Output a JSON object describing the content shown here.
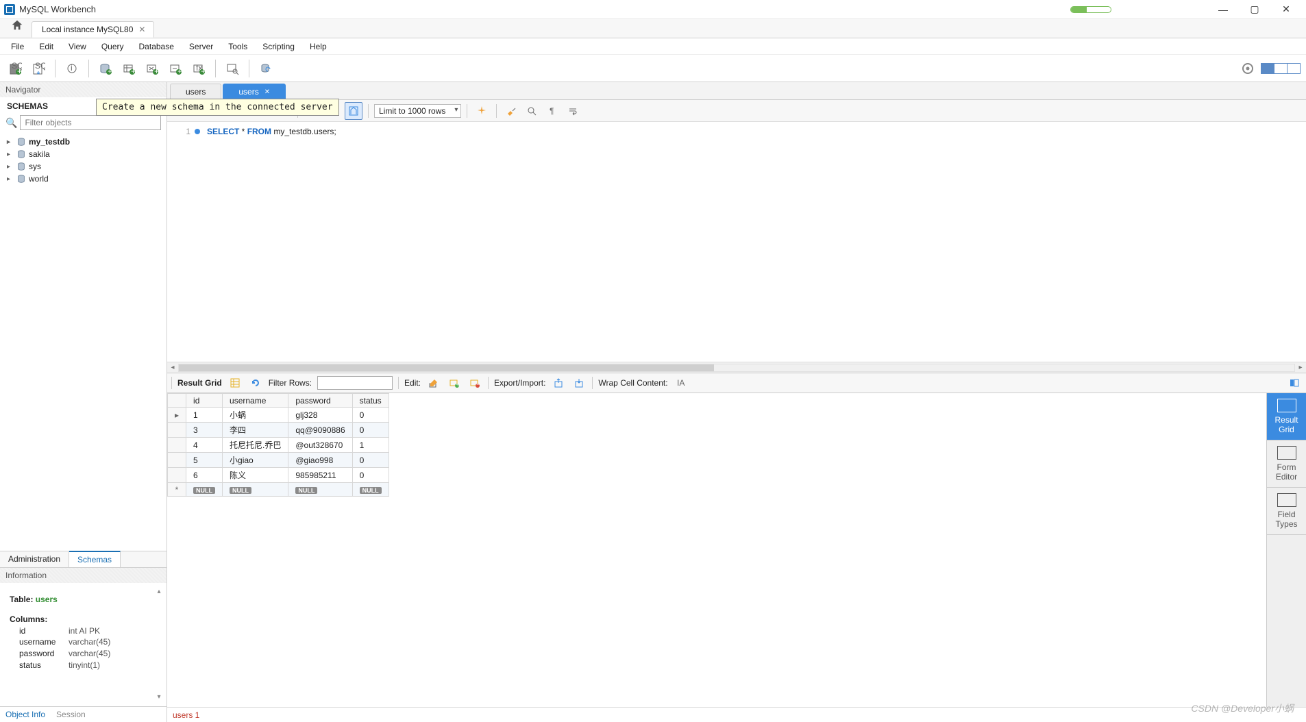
{
  "window": {
    "title": "MySQL Workbench",
    "connection_tab": "Local instance MySQL80"
  },
  "menu": [
    "File",
    "Edit",
    "View",
    "Query",
    "Database",
    "Server",
    "Tools",
    "Scripting",
    "Help"
  ],
  "tooltip": "Create a new schema in the connected server",
  "navigator": {
    "title": "Navigator",
    "schemas_label": "SCHEMAS",
    "filter_placeholder": "Filter objects",
    "schemas": [
      {
        "name": "my_testdb",
        "bold": true
      },
      {
        "name": "sakila",
        "bold": false
      },
      {
        "name": "sys",
        "bold": false
      },
      {
        "name": "world",
        "bold": false
      }
    ],
    "bottom_tabs": {
      "admin": "Administration",
      "schemas": "Schemas",
      "active": "schemas"
    }
  },
  "information": {
    "title": "Information",
    "table_label": "Table:",
    "table_name": "users",
    "columns_label": "Columns:",
    "columns": [
      {
        "name": "id",
        "type": "int AI PK"
      },
      {
        "name": "username",
        "type": "varchar(45)"
      },
      {
        "name": "password",
        "type": "varchar(45)"
      },
      {
        "name": "status",
        "type": "tinyint(1)"
      }
    ],
    "bottom_tabs": {
      "object_info": "Object Info",
      "session": "Session"
    }
  },
  "editor": {
    "tabs": [
      {
        "label": "users",
        "active": false
      },
      {
        "label": "users",
        "active": true,
        "closable": true
      }
    ],
    "limit_label": "Limit to 1000 rows",
    "line_number": "1",
    "sql_select": "SELECT",
    "sql_star": " * ",
    "sql_from": "FROM",
    "sql_rest": " my_testdb.users;"
  },
  "result_toolbar": {
    "result_grid": "Result Grid",
    "filter_rows": "Filter Rows:",
    "edit": "Edit:",
    "export_import": "Export/Import:",
    "wrap_cell": "Wrap Cell Content:"
  },
  "result": {
    "columns": [
      "id",
      "username",
      "password",
      "status"
    ],
    "rows": [
      {
        "id": "1",
        "username": "小蜗",
        "password": "glj328",
        "status": "0"
      },
      {
        "id": "3",
        "username": "李四",
        "password": "qq@9090886",
        "status": "0"
      },
      {
        "id": "4",
        "username": "托尼托尼.乔巴",
        "password": "@out328670",
        "status": "1"
      },
      {
        "id": "5",
        "username": "小giao",
        "password": "@giao998",
        "status": "0"
      },
      {
        "id": "6",
        "username": "陈义",
        "password": "985985211",
        "status": "0"
      }
    ],
    "null_label": "NULL"
  },
  "side_tabs": {
    "result_grid": "Result Grid",
    "form_editor": "Form Editor",
    "field_types": "Field Types"
  },
  "status_tabs": {
    "tab1": "users 1"
  },
  "watermark": "CSDN @Developer小蜗"
}
